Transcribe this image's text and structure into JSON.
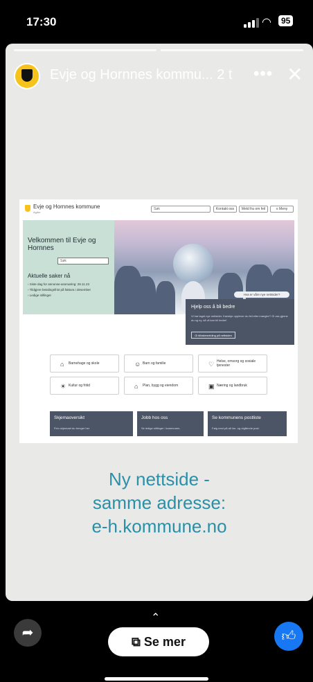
{
  "status": {
    "time": "17:30",
    "battery": "95"
  },
  "story": {
    "title": "Evje og Hornnes kommu... 2 t",
    "more_icon": "more-dots-icon",
    "close_icon": "close-icon"
  },
  "site": {
    "name": "Evje og Hornnes kommune",
    "sub": "Agder",
    "search_placeholder": "Søk",
    "buttons": [
      "Kontakt oss",
      "Meld fra om feil",
      "≡ Meny"
    ],
    "hero_title": "Velkommen til Evje og Hornnes",
    "hero_search": "Søk",
    "cases_title": "Aktuelle saker nå",
    "cases": [
      "› Siste dag for annonse-ansmøring: 29.11.23",
      "› Tildgjere betalingsfrist på faktura i desember",
      "› Ledige stillinger"
    ],
    "new_site_tag": "Hva er våre nye nettsider?",
    "help": {
      "title": "Hjelp oss å bli bedre",
      "text": "Vi har laget nye nettsider. Kanskje opplever du feil eller mangler? Gi oss gjerne du og ny, så vil kan bli bedre!",
      "button": "Gi tilbakemelding på nettsiden"
    },
    "categories": [
      {
        "label": "Barnehage og skole",
        "icon": "building-icon"
      },
      {
        "label": "Barn og familie",
        "icon": "family-icon"
      },
      {
        "label": "Helse, omsorg og sosiale tjenester",
        "icon": "health-icon"
      },
      {
        "label": "Kultur og fritid",
        "icon": "culture-icon"
      },
      {
        "label": "Plan, bygg og eiendom",
        "icon": "house-icon"
      },
      {
        "label": "Næring og landbruk",
        "icon": "business-icon"
      }
    ],
    "cards": [
      {
        "title": "Skjemaoversikt",
        "sub": "Finn skjemaet du trenger her"
      },
      {
        "title": "Jobb hos oss",
        "sub": "Se ledige stillinger i kommunen."
      },
      {
        "title": "Se kommunens postliste",
        "sub": "Følg med på alt inn- og utgående post."
      }
    ]
  },
  "caption": [
    "Ny nettside -",
    "samme adresse:",
    "e-h.kommune.no"
  ],
  "bottom": {
    "see_more": "Se mer"
  }
}
